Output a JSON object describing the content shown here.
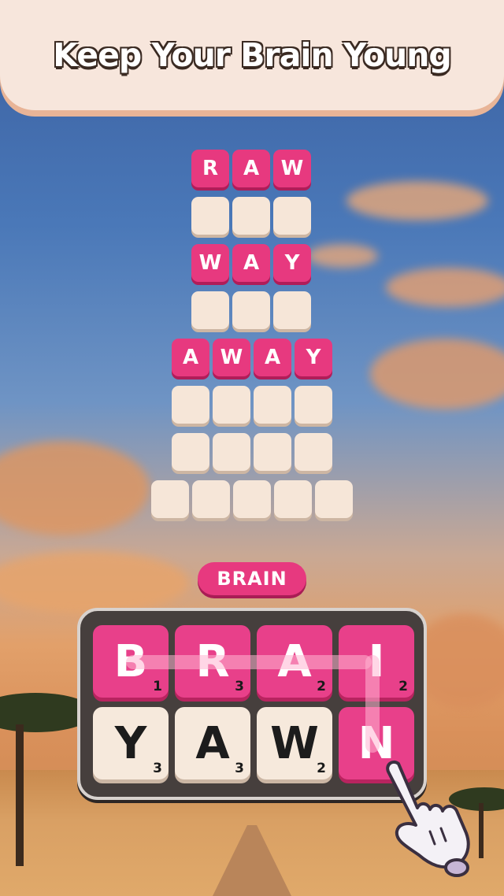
{
  "banner": {
    "title": "Keep Your Brain Young"
  },
  "ladder": {
    "rows": [
      {
        "letters": [
          "R",
          "A",
          "W"
        ],
        "solved": true
      },
      {
        "letters": [
          "",
          "",
          ""
        ],
        "solved": false
      },
      {
        "letters": [
          "W",
          "A",
          "Y"
        ],
        "solved": true
      },
      {
        "letters": [
          "",
          "",
          ""
        ],
        "solved": false
      },
      {
        "letters": [
          "A",
          "W",
          "A",
          "Y"
        ],
        "solved": true
      },
      {
        "letters": [
          "",
          "",
          "",
          ""
        ],
        "solved": false
      },
      {
        "letters": [
          "",
          "",
          "",
          ""
        ],
        "solved": false
      },
      {
        "letters": [
          "",
          "",
          "",
          "",
          ""
        ],
        "solved": false
      }
    ]
  },
  "current_word": "BRAIN",
  "board": {
    "tiles": [
      {
        "letter": "B",
        "score": "1",
        "selected": true
      },
      {
        "letter": "R",
        "score": "3",
        "selected": true
      },
      {
        "letter": "A",
        "score": "2",
        "selected": true
      },
      {
        "letter": "I",
        "score": "2",
        "selected": true
      },
      {
        "letter": "Y",
        "score": "3",
        "selected": false
      },
      {
        "letter": "A",
        "score": "3",
        "selected": false
      },
      {
        "letter": "W",
        "score": "2",
        "selected": false
      },
      {
        "letter": "N",
        "score": "",
        "selected": true
      }
    ]
  },
  "icons": {
    "pointer": "pointing-hand-icon"
  },
  "colors": {
    "accent": "#e7397f",
    "tile_empty": "#f6e6d8",
    "board": "#463f3d"
  }
}
